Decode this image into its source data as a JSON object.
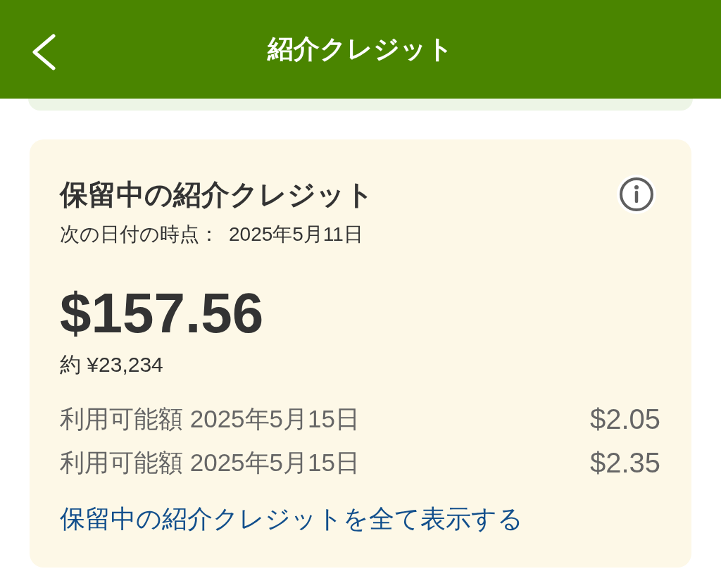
{
  "header": {
    "title": "紹介クレジット"
  },
  "pending_card": {
    "title": "保留中の紹介クレジット",
    "as_of_label": "次の日付の時点：",
    "as_of_date": "2025年5月11日",
    "amount": "$157.56",
    "approx": "約 ¥23,234",
    "entries": [
      {
        "label": "利用可能額 2025年5月15日",
        "amount": "$2.05"
      },
      {
        "label": "利用可能額 2025年5月15日",
        "amount": "$2.35"
      }
    ],
    "link": "保留中の紹介クレジットを全て表示する"
  }
}
